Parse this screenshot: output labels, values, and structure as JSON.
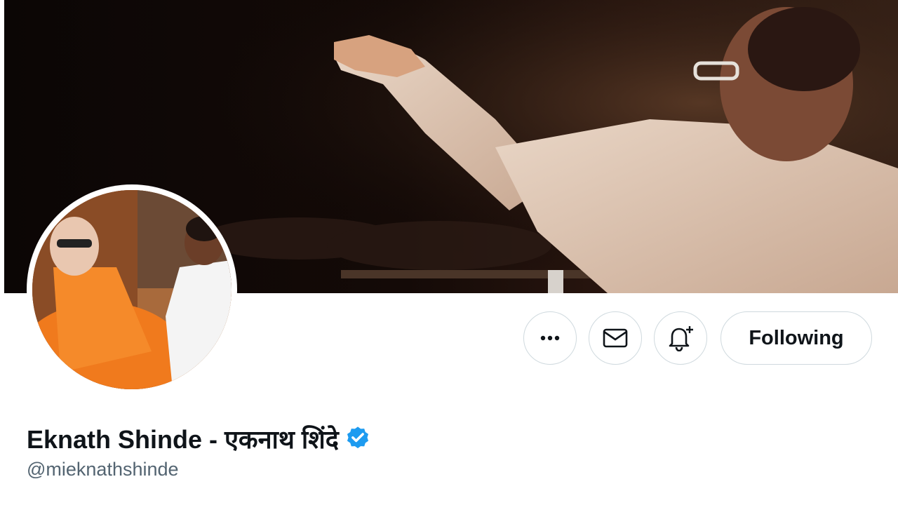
{
  "profile": {
    "display_name": "Eknath Shinde - एकनाथ शिंदे",
    "handle": "@mieknathshinde",
    "verified": true
  },
  "actions": {
    "follow_label": "Following",
    "more_icon": "more-horizontal-icon",
    "message_icon": "mail-icon",
    "notify_icon": "bell-plus-icon"
  },
  "colors": {
    "primary_text": "#0f1419",
    "secondary_text": "#536471",
    "verified_blue": "#1d9bf0",
    "button_border": "#cfd9de"
  }
}
